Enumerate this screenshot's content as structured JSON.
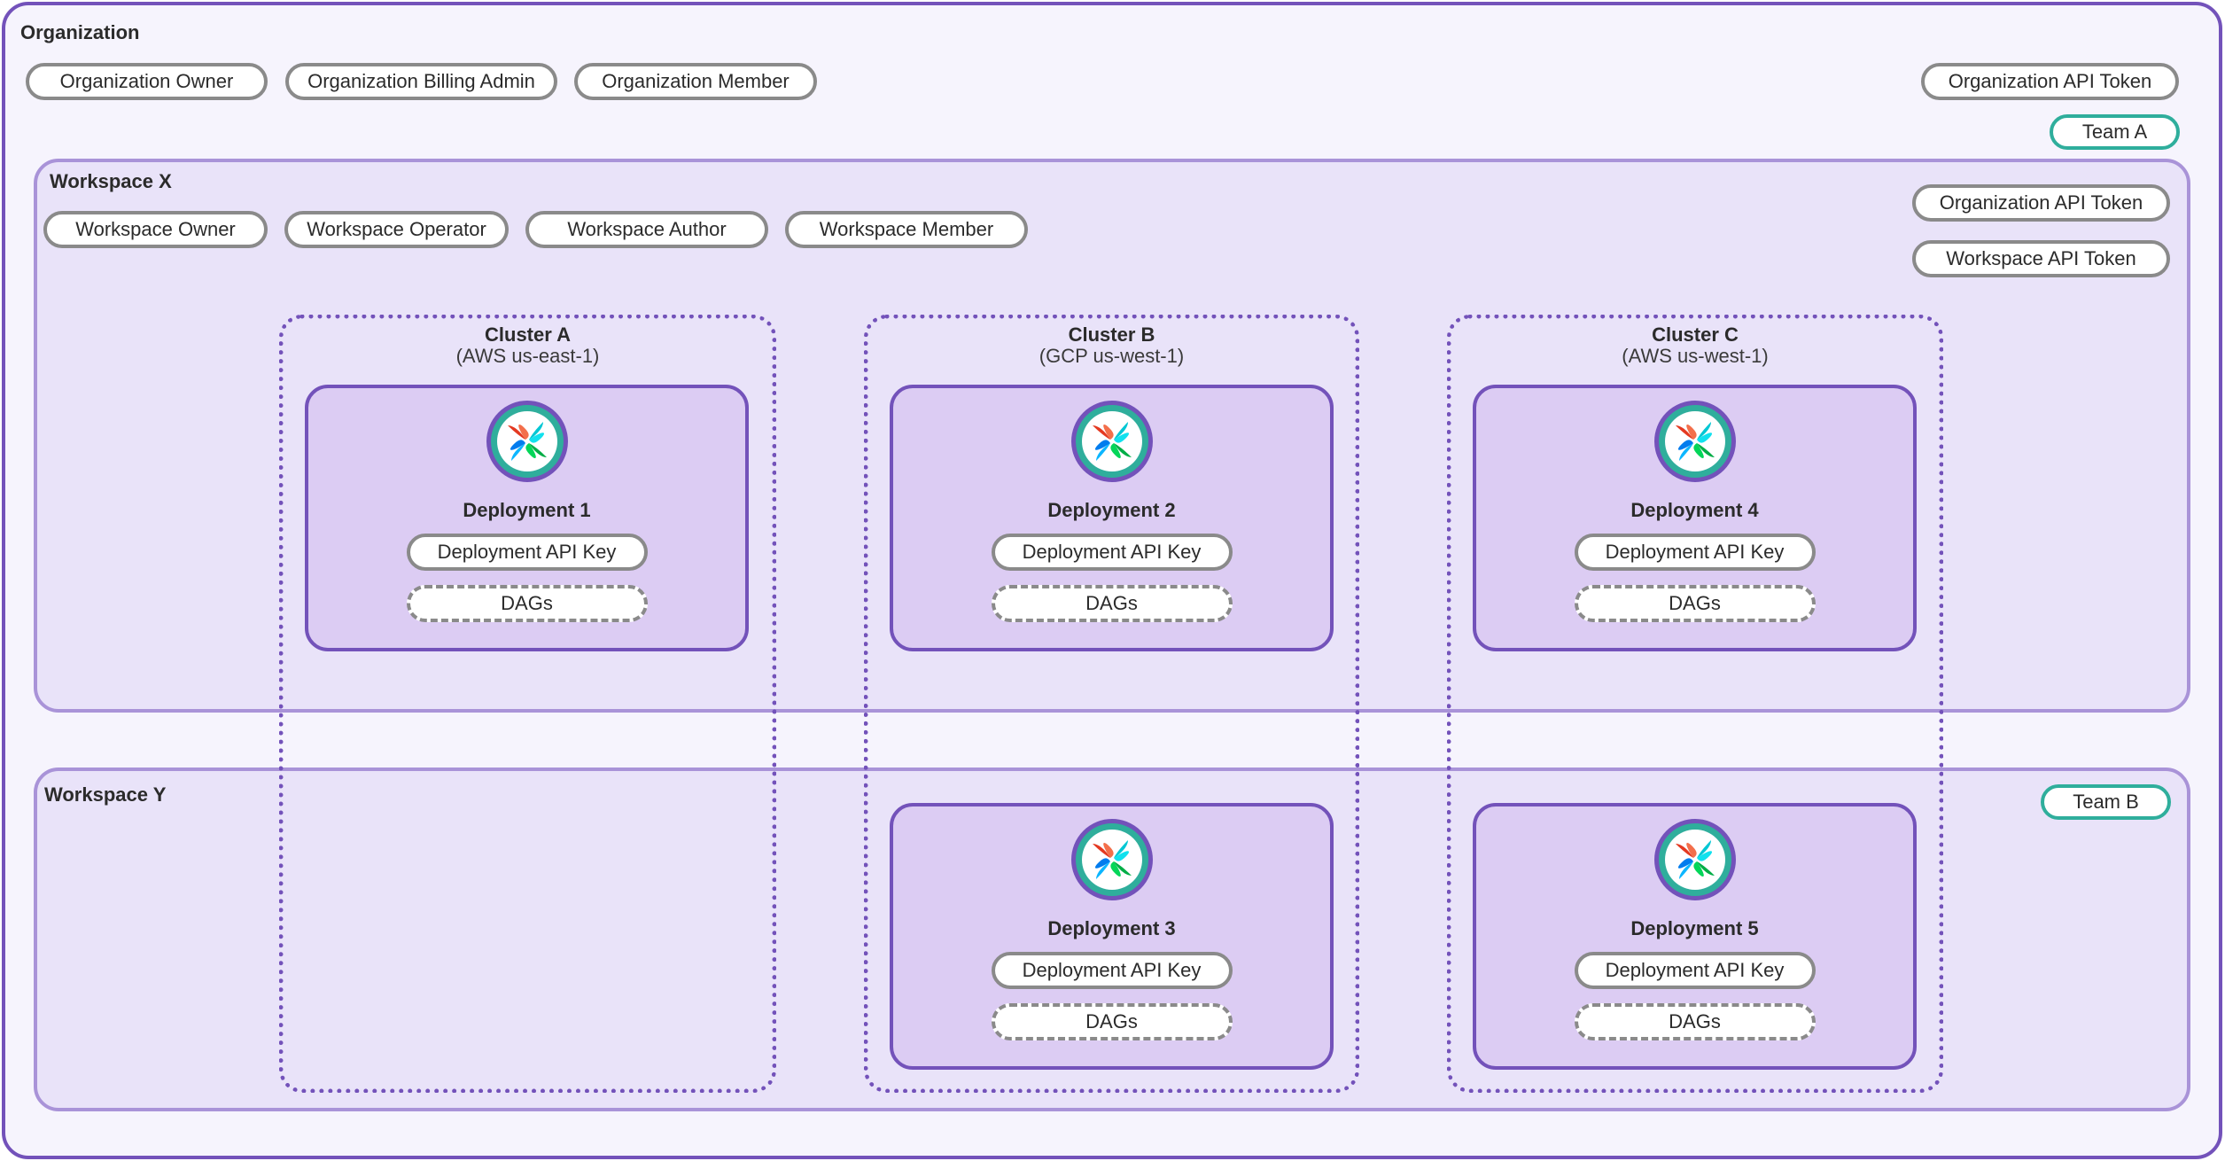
{
  "organization": {
    "title": "Organization",
    "roles": [
      "Organization Owner",
      "Organization Billing Admin",
      "Organization Member"
    ],
    "api_token": "Organization API Token",
    "team": "Team A"
  },
  "workspace_x": {
    "title": "Workspace X",
    "roles": [
      "Workspace Owner",
      "Workspace Operator",
      "Workspace Author",
      "Workspace Member"
    ],
    "tokens": [
      "Organization API Token",
      "Workspace API Token"
    ]
  },
  "workspace_y": {
    "title": "Workspace Y",
    "team": "Team B"
  },
  "clusters": [
    {
      "name": "Cluster A",
      "region": "(AWS us-east-1)"
    },
    {
      "name": "Cluster B",
      "region": "(GCP us-west-1)"
    },
    {
      "name": "Cluster C",
      "region": "(AWS us-west-1)"
    }
  ],
  "deployments": [
    {
      "name": "Deployment 1",
      "api_key": "Deployment API Key",
      "dags": "DAGs",
      "icon": "airflow-pinwheel-icon"
    },
    {
      "name": "Deployment 2",
      "api_key": "Deployment API Key",
      "dags": "DAGs",
      "icon": "airflow-pinwheel-icon"
    },
    {
      "name": "Deployment 4",
      "api_key": "Deployment API Key",
      "dags": "DAGs",
      "icon": "airflow-pinwheel-icon"
    },
    {
      "name": "Deployment 3",
      "api_key": "Deployment API Key",
      "dags": "DAGs",
      "icon": "airflow-pinwheel-icon"
    },
    {
      "name": "Deployment 5",
      "api_key": "Deployment API Key",
      "dags": "DAGs",
      "icon": "airflow-pinwheel-icon"
    }
  ],
  "colors": {
    "org_border": "#7352ba",
    "workspace_border": "#a993d8",
    "team_border": "#2fae9c",
    "pill_border": "#8a8a8a",
    "deployment_fill": "#dcccf3"
  }
}
